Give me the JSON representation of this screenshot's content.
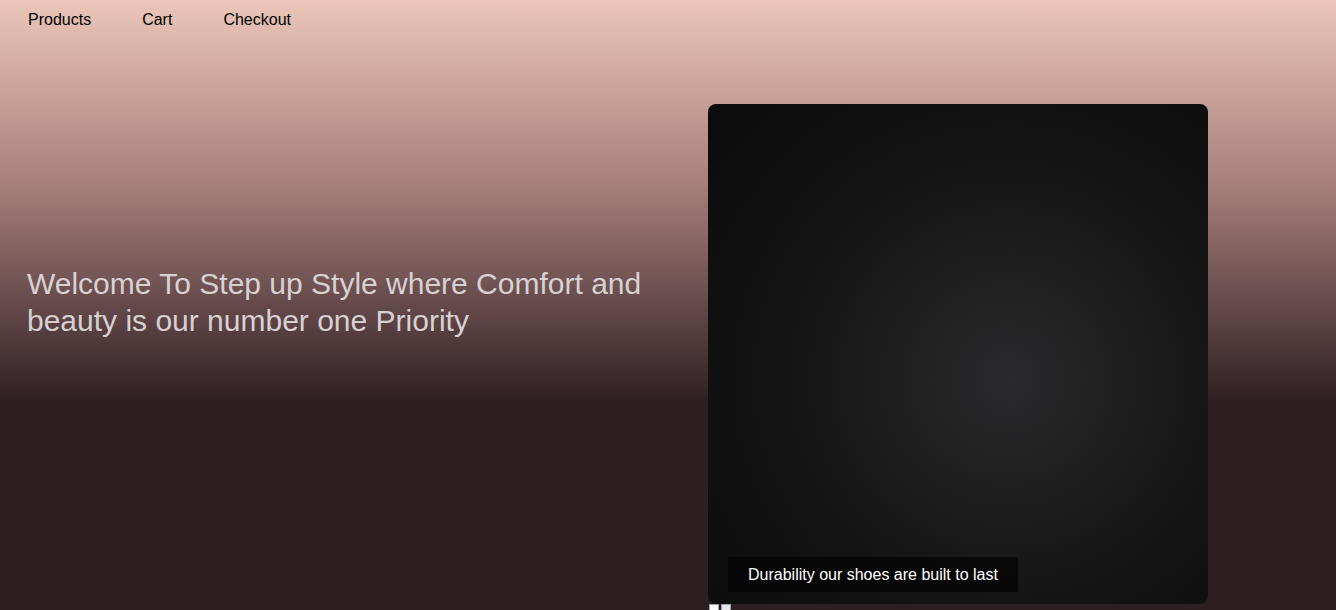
{
  "nav": {
    "items": [
      {
        "label": "Products"
      },
      {
        "label": "Cart"
      },
      {
        "label": "Checkout"
      }
    ]
  },
  "hero": {
    "headline": "Welcome To Step up Style where Comfort and beauty is our number one Priority"
  },
  "carousel": {
    "caption": "Durability our shoes are built to last",
    "indicators": [
      {
        "selected": true
      },
      {
        "selected": false
      }
    ]
  }
}
